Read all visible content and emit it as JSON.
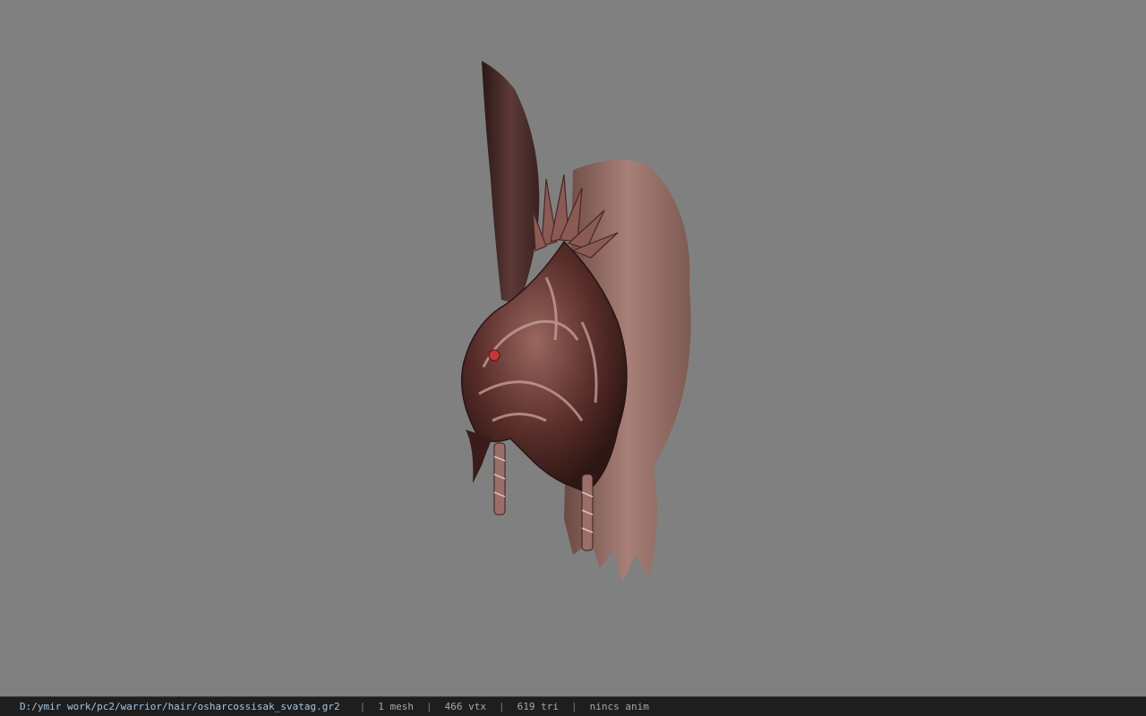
{
  "viewport": {
    "background": "#808080",
    "model_icon": "helmet-hair-mesh"
  },
  "status": {
    "file_path": "D:/ymir work/pc2/warrior/hair/osharcossisak_svatag.gr2",
    "separator": "|",
    "mesh_count": "1 mesh",
    "vertex_count": "466 vtx",
    "triangle_count": "619 tri",
    "animation": "nincs anim"
  },
  "colors": {
    "statusbar_bg": "#1e1e1e",
    "path_text": "#9fc7e8",
    "stat_text": "#a8a8a8"
  }
}
